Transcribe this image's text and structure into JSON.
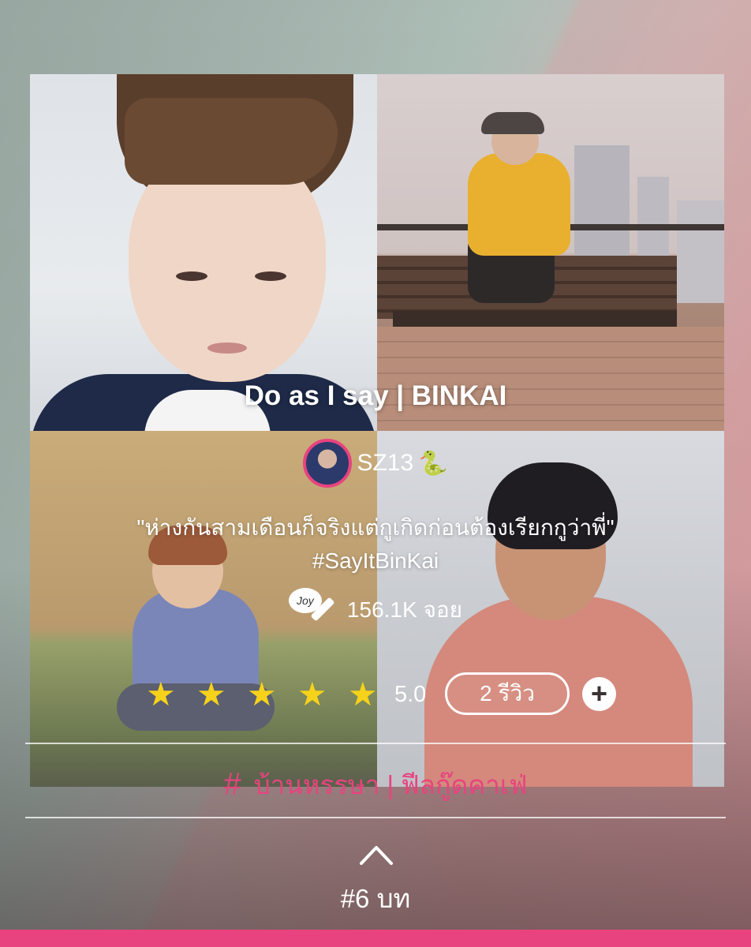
{
  "story": {
    "title": "Do as I say | BINKAI",
    "author": "SZ13",
    "author_emoji_icon": "snake-icon",
    "tagline_line1": "\"ห่างกันสามเดือนก็จริงแต่กูเกิดก่อนต้องเรียกกูว่าพี่\"",
    "tagline_line2": "#SayItBinKai",
    "joy_count": "156.1K จอย",
    "rating_value": 5.0,
    "rating_text": "5.0",
    "stars": 5,
    "review_label": "2 รีวิว",
    "plus_label": "+",
    "category": "บ้านหรรษา | ฟีลกู๊ดคาเฟ่",
    "chapters": "#6 บท"
  },
  "colors": {
    "accent": "#e8437f",
    "star": "#f7d21a",
    "text": "#ffffff"
  }
}
